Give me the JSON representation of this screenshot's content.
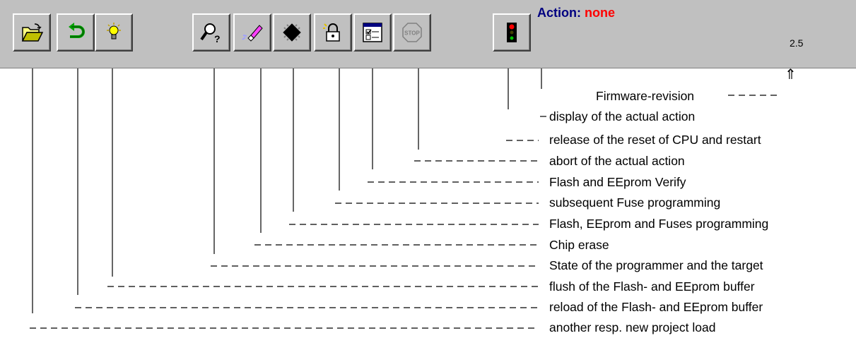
{
  "toolbar": {
    "buttons": [
      {
        "name": "open-project-button",
        "icon": "folder-open-icon"
      },
      {
        "name": "reload-button",
        "icon": "undo-arrow-icon"
      },
      {
        "name": "flush-button",
        "icon": "lightbulb-icon"
      },
      {
        "name": "state-button",
        "icon": "magnifier-question-icon"
      },
      {
        "name": "chip-erase-button",
        "icon": "eraser-icon"
      },
      {
        "name": "program-button",
        "icon": "chip-icon"
      },
      {
        "name": "fuse-button",
        "icon": "padlock-icon"
      },
      {
        "name": "verify-button",
        "icon": "checklist-window-icon"
      },
      {
        "name": "abort-button",
        "icon": "stop-sign-icon"
      },
      {
        "name": "reset-button",
        "icon": "traffic-light-icon"
      }
    ],
    "action_label": "Action:",
    "action_value": "none",
    "firmware_version": "2.5",
    "colors": {
      "action_label": "#000080",
      "action_value": "#ff0000",
      "toolbar_bg": "#c0c0c0"
    }
  },
  "legend": {
    "firmware_revision": "Firmware-revision",
    "up_arrow": "⇑",
    "items": [
      "display of the actual action",
      "release of the reset of CPU and restart",
      "abort of the actual action",
      "Flash and EEprom Verify",
      "subsequent Fuse programming",
      "Flash, EEprom and Fuses programming",
      "Chip erase",
      "State of the programmer and the target",
      "flush of the Flash- and EEprom buffer",
      "reload of the Flash- and EEprom buffer",
      "another resp. new project load"
    ]
  }
}
